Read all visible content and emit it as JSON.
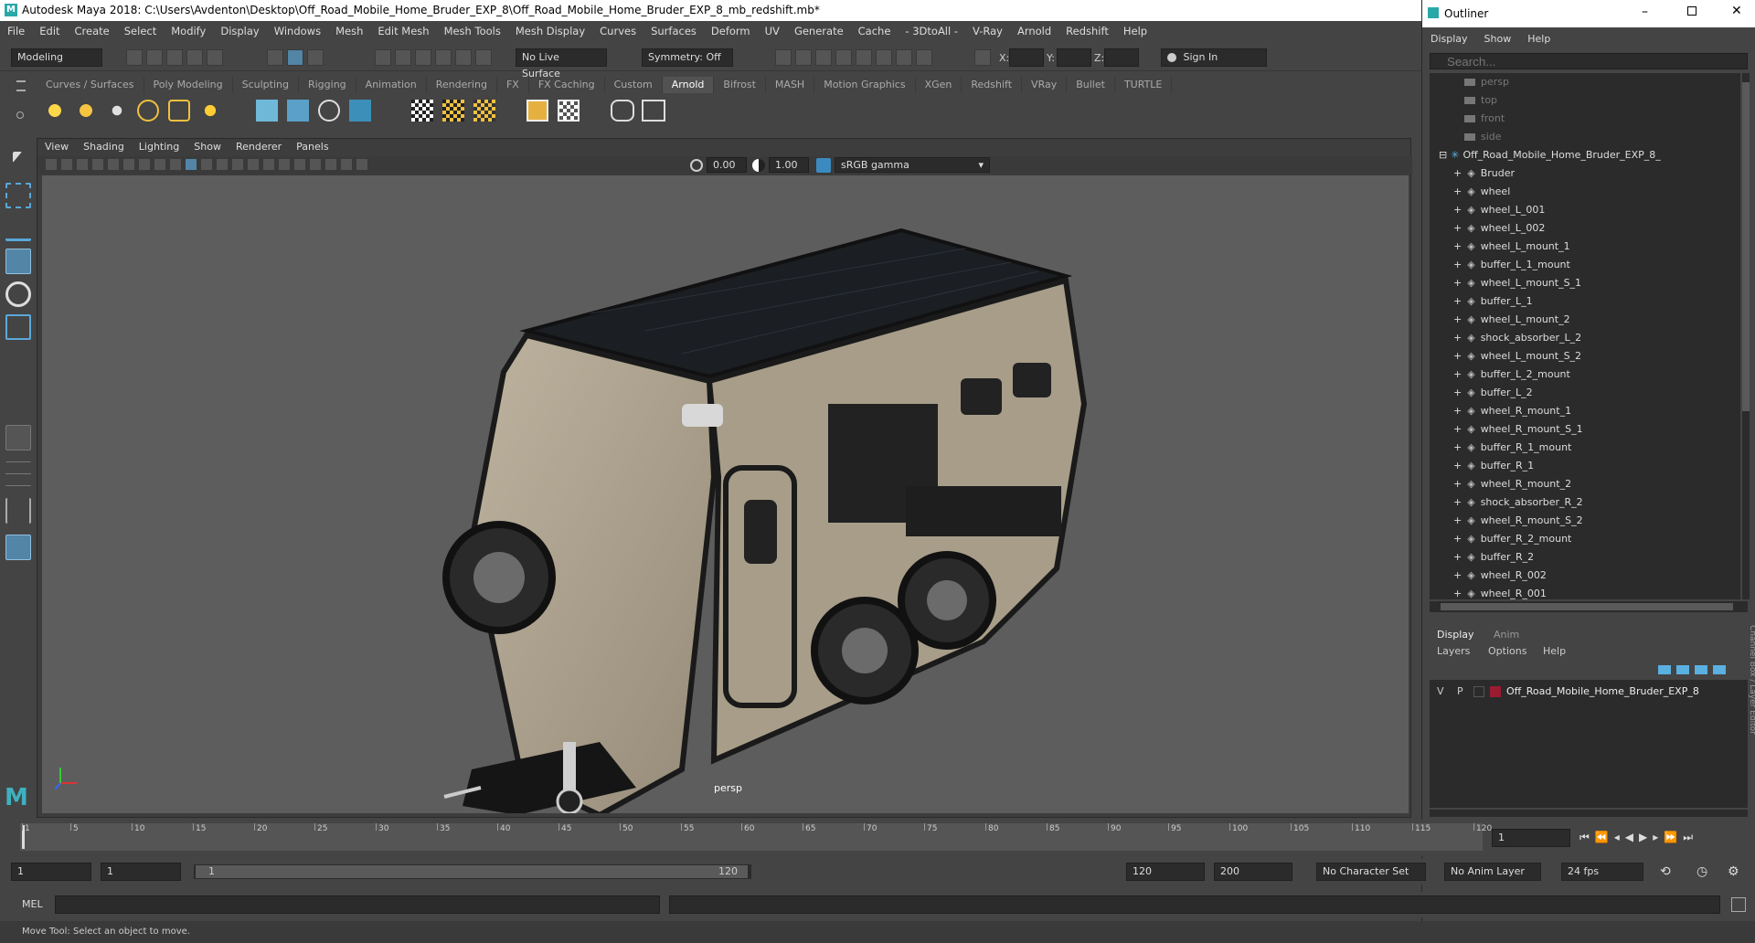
{
  "window": {
    "title": "Autodesk Maya 2018: C:\\Users\\Avdenton\\Desktop\\Off_Road_Mobile_Home_Bruder_EXP_8\\Off_Road_Mobile_Home_Bruder_EXP_8_mb_redshift.mb*"
  },
  "menubar": [
    "File",
    "Edit",
    "Create",
    "Select",
    "Modify",
    "Display",
    "Windows",
    "Mesh",
    "Edit Mesh",
    "Mesh Tools",
    "Mesh Display",
    "Curves",
    "Surfaces",
    "Deform",
    "UV",
    "Generate",
    "Cache",
    "- 3DtoAll -",
    "V-Ray",
    "Arnold",
    "Redshift",
    "Help"
  ],
  "statusline": {
    "mode": "Modeling",
    "live_surface": "No Live Surface",
    "symmetry": "Symmetry: Off",
    "x_label": "X:",
    "y_label": "Y:",
    "z_label": "Z:",
    "sign_in": "Sign In"
  },
  "shelf_tabs": [
    "Curves / Surfaces",
    "Poly Modeling",
    "Sculpting",
    "Rigging",
    "Animation",
    "Rendering",
    "FX",
    "FX Caching",
    "Custom",
    "Arnold",
    "Bifrost",
    "MASH",
    "Motion Graphics",
    "XGen",
    "Redshift",
    "VRay",
    "Bullet",
    "TURTLE"
  ],
  "shelf_active": "Arnold",
  "panel_menu": [
    "View",
    "Shading",
    "Lighting",
    "Show",
    "Renderer",
    "Panels"
  ],
  "panel_toolbar": {
    "exposure": "0.00",
    "gamma": "1.00",
    "colorspace": "sRGB gamma"
  },
  "viewport": {
    "camera_label": "persp"
  },
  "outliner": {
    "title": "Outliner",
    "menu": [
      "Display",
      "Show",
      "Help"
    ],
    "search_placeholder": "Search...",
    "cameras": [
      "persp",
      "top",
      "front",
      "side"
    ],
    "group": "Off_Road_Mobile_Home_Bruder_EXP_8_",
    "children": [
      "Bruder",
      "wheel",
      "wheel_L_001",
      "wheel_L_002",
      "wheel_L_mount_1",
      "buffer_L_1_mount",
      "wheel_L_mount_S_1",
      "buffer_L_1",
      "wheel_L_mount_2",
      "shock_absorber_L_2",
      "wheel_L_mount_S_2",
      "buffer_L_2_mount",
      "buffer_L_2",
      "wheel_R_mount_1",
      "wheel_R_mount_S_1",
      "buffer_R_1_mount",
      "buffer_R_1",
      "wheel_R_mount_2",
      "shock_absorber_R_2",
      "wheel_R_mount_S_2",
      "buffer_R_2_mount",
      "buffer_R_2",
      "wheel_R_002",
      "wheel_R_001"
    ]
  },
  "layer_editor": {
    "tabs": [
      "Display",
      "Anim"
    ],
    "menu": [
      "Layers",
      "Options",
      "Help"
    ],
    "layer": {
      "v": "V",
      "p": "P",
      "name": "Off_Road_Mobile_Home_Bruder_EXP_8",
      "color": "#9b1b30"
    },
    "side_label": "Channel Box / Layer Editor"
  },
  "timeslider": {
    "ticks": [
      "1",
      "5",
      "10",
      "15",
      "20",
      "25",
      "30",
      "35",
      "40",
      "45",
      "50",
      "55",
      "60",
      "65",
      "70",
      "75",
      "80",
      "85",
      "90",
      "95",
      "100",
      "105",
      "110",
      "115",
      "120"
    ],
    "current_frame": "1"
  },
  "range": {
    "start": "1",
    "playback_start": "1",
    "range_start": "1",
    "range_end": "120",
    "playback_end": "120",
    "end": "200",
    "character_set": "No Character Set",
    "anim_layer": "No Anim Layer",
    "fps": "24 fps"
  },
  "cmdline": {
    "label": "MEL"
  },
  "helpline": {
    "text": "Move Tool: Select an object to move."
  },
  "colors": {
    "accent": "#5285a6",
    "bg": "#444444",
    "viewport": "#5d5d5d"
  }
}
